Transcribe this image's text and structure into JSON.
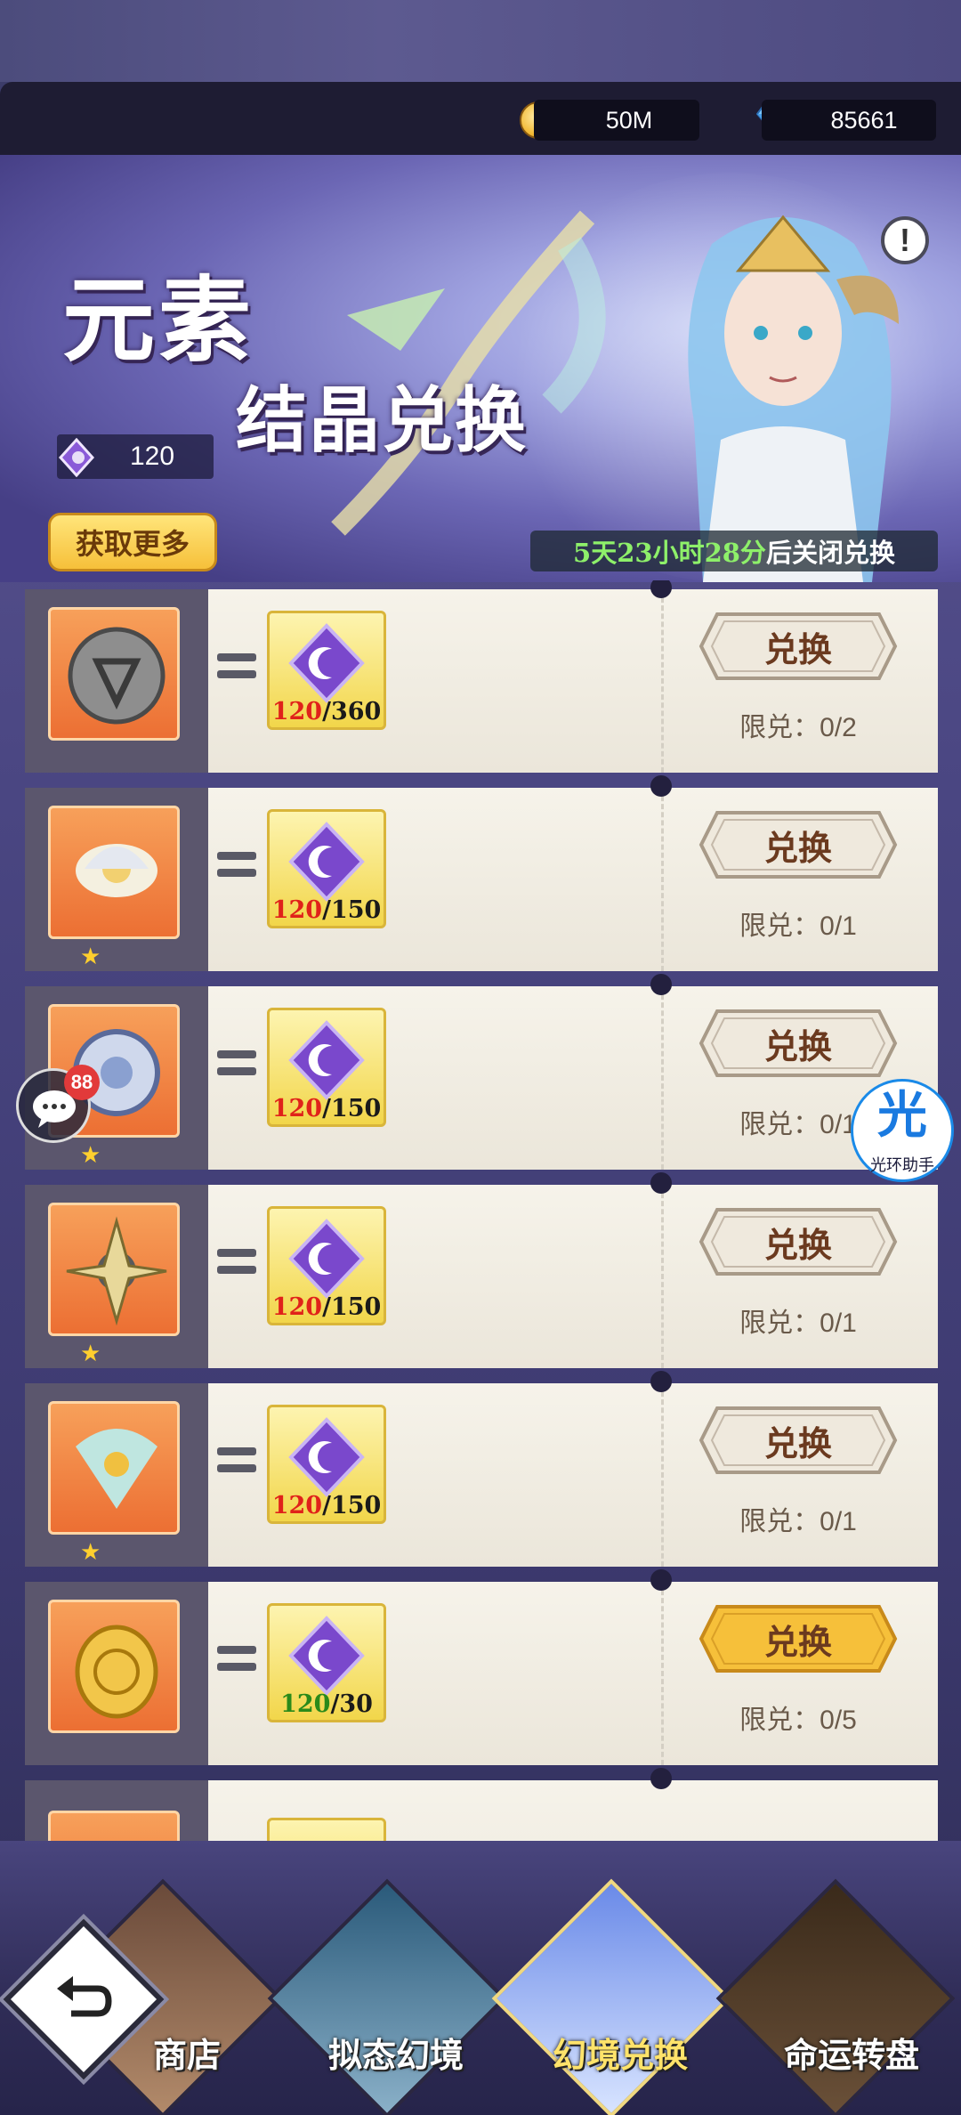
{
  "resources": {
    "gold": "50M",
    "diamonds": "85661"
  },
  "banner": {
    "title_line1": "元素",
    "title_line2": "结晶兑换",
    "crystal_count": "120",
    "get_more_label": "获取更多",
    "timer_time": "5天23小时28分",
    "timer_suffix": "后关闭兑换",
    "info_label": "!"
  },
  "exchange_items": [
    {
      "item_icon": "rune-stone-icon",
      "stars": "",
      "cost_have": "120",
      "cost_need": "360",
      "affordable": false,
      "button_label": "兑换",
      "button_active": false,
      "limit_label": "限兑：",
      "limit_value": "0/2"
    },
    {
      "item_icon": "lotus-ornament-icon",
      "stars": "★",
      "cost_have": "120",
      "cost_need": "150",
      "affordable": false,
      "button_label": "兑换",
      "button_active": false,
      "limit_label": "限兑：",
      "limit_value": "0/1"
    },
    {
      "item_icon": "wheel-relic-icon",
      "stars": "★",
      "cost_have": "120",
      "cost_need": "150",
      "affordable": false,
      "button_label": "兑换",
      "button_active": false,
      "limit_label": "限兑：",
      "limit_value": "0/1"
    },
    {
      "item_icon": "shuriken-relic-icon",
      "stars": "★",
      "cost_have": "120",
      "cost_need": "150",
      "affordable": false,
      "button_label": "兑换",
      "button_active": false,
      "limit_label": "限兑：",
      "limit_value": "0/1"
    },
    {
      "item_icon": "peacock-fan-icon",
      "stars": "★",
      "cost_have": "120",
      "cost_need": "150",
      "affordable": false,
      "button_label": "兑换",
      "button_active": false,
      "limit_label": "限兑：",
      "limit_value": "0/1"
    },
    {
      "item_icon": "gold-coin-icon",
      "stars": "",
      "cost_have": "120",
      "cost_need": "30",
      "affordable": true,
      "button_label": "兑换",
      "button_active": true,
      "limit_label": "限兑：",
      "limit_value": "0/5"
    }
  ],
  "overlays": {
    "chat_badge": "88",
    "helper_glyph": "光",
    "helper_label": "光环助手"
  },
  "nav": {
    "tabs": [
      {
        "label": "商店"
      },
      {
        "label": "拟态幻境"
      },
      {
        "label": "幻境兑换",
        "active": true
      },
      {
        "label": "命运转盘"
      }
    ]
  },
  "colors": {
    "accent_gold": "#f6c03a",
    "cost_red": "#e0221a",
    "cost_green": "#2a8a1a",
    "timer_green": "#8ef06a"
  }
}
